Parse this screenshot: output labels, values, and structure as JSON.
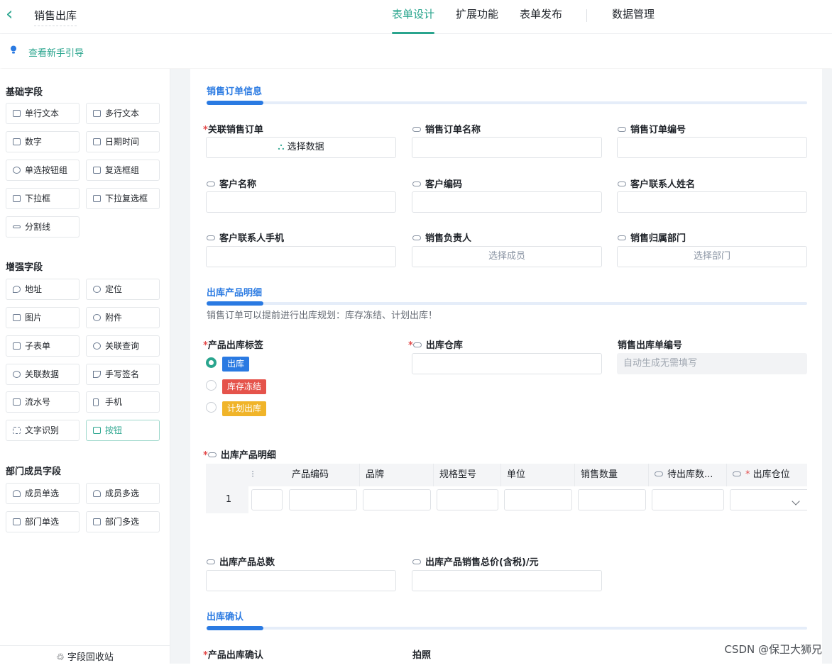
{
  "header": {
    "back_icon": "chevron-left-icon",
    "title": "销售出库",
    "tabs": [
      "表单设计",
      "扩展功能",
      "表单发布"
    ],
    "data_tab": "数据管理"
  },
  "guide": {
    "icon": "lightbulb-icon",
    "text": "查看新手引导"
  },
  "sidebar": {
    "basic": {
      "title": "基础字段",
      "items": [
        "单行文本",
        "多行文本",
        "数字",
        "日期时间",
        "单选按钮组",
        "复选框组",
        "下拉框",
        "下拉复选框",
        "分割线"
      ]
    },
    "enhanced": {
      "title": "增强字段",
      "items": [
        "地址",
        "定位",
        "图片",
        "附件",
        "子表单",
        "关联查询",
        "关联数据",
        "手写签名",
        "流水号",
        "手机",
        "文字识别",
        "按钮"
      ]
    },
    "member": {
      "title": "部门成员字段",
      "items": [
        "成员单选",
        "成员多选",
        "部门单选",
        "部门多选"
      ]
    },
    "recycle": "字段回收站"
  },
  "form": {
    "sec1": "销售订单信息",
    "f_order": "关联销售订单",
    "f_order_btn": "选择数据",
    "f_order_name": "销售订单名称",
    "f_order_no": "销售订单编号",
    "f_cust_name": "客户名称",
    "f_cust_code": "客户编码",
    "f_contact": "客户联系人姓名",
    "f_contact_phone": "客户联系人手机",
    "f_sales": "销售负责人",
    "f_sales_ph": "选择成员",
    "f_dept": "销售归属部门",
    "f_dept_ph": "选择部门",
    "sec2": "出库产品明细",
    "note": "销售订单可以提前进行出库规划：库存冻结、计划出库！",
    "f_tag": "产品出库标签",
    "tags": [
      "出库",
      "库存冻结",
      "计划出库"
    ],
    "f_wh": "出库仓库",
    "f_out_no": "销售出库单编号",
    "f_out_no_ph": "自动生成无需填写",
    "f_detail": "出库产品明细",
    "table": {
      "cols": [
        "产品编码",
        "品牌",
        "规格型号",
        "单位",
        "销售数量",
        "待出库数...",
        "出库仓位"
      ],
      "row": "1"
    },
    "f_total": "出库产品总数",
    "f_total_price": "出库产品销售总价(含税)/元",
    "sec3": "出库确认",
    "f_confirm": "产品出库确认",
    "f_photo": "拍照"
  },
  "colors": {
    "accent": "#2aa58e",
    "blue": "#2a7ae2",
    "tag_out": "#2a7ae2",
    "tag_freeze": "#e5534b",
    "tag_plan": "#f0b429"
  },
  "watermark": "CSDN @保卫大狮兄"
}
